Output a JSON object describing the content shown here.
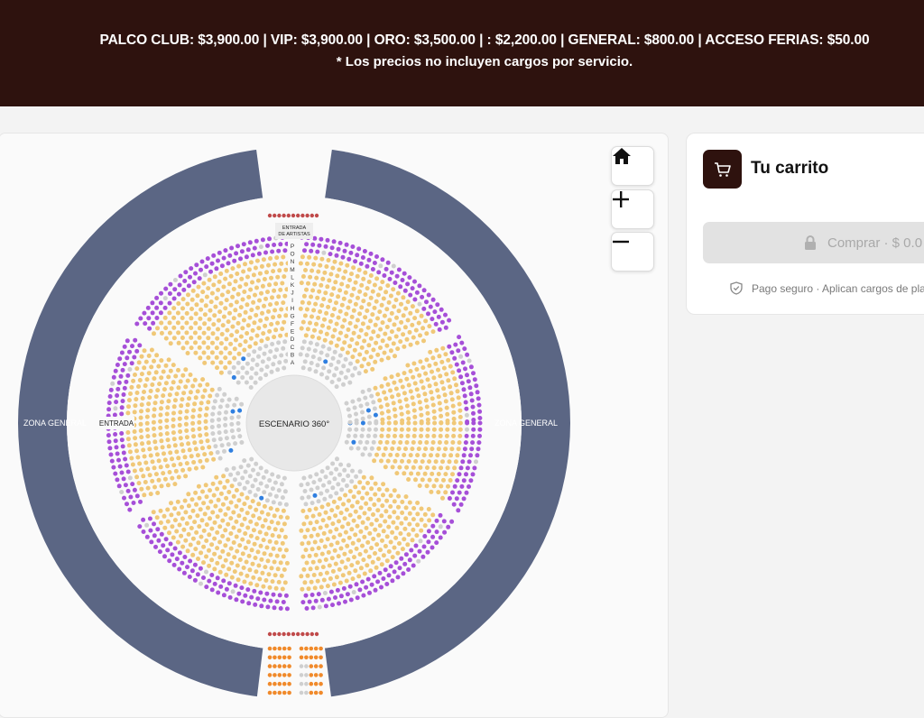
{
  "banner": {
    "prices": "PALCO CLUB: $3,900.00 | VIP: $3,900.00 | ORO: $3,500.00 | : $2,200.00 | GENERAL: $800.00 | ACCESO FERIAS: $50.00",
    "note": "* Los precios no incluyen cargos por servicio."
  },
  "map": {
    "zone_left": "ZONA GENERAL",
    "zone_right": "ZONA GENERAL",
    "stage": "ESCENARIO 360°",
    "entrance": "ENTRADA",
    "artists_entrance_line1": "ENTRADA",
    "artists_entrance_line2": "DE ARTISTAS",
    "rows": [
      "P",
      "O",
      "N",
      "M",
      "L",
      "K",
      "J",
      "I",
      "H",
      "G",
      "F",
      "E",
      "D",
      "C",
      "B",
      "A"
    ],
    "colors": {
      "general_zone": "#5b6684",
      "palco": "#c04a4a",
      "vip": "#a64fd8",
      "oro": "#f0c878",
      "unavailable": "#cfcfcf",
      "selected": "#2f7fe0",
      "orange_section": "#f08a2b"
    },
    "controls": {
      "home_icon": "home-icon",
      "zoom_in_icon": "plus-icon",
      "zoom_out_icon": "minus-icon"
    }
  },
  "cart": {
    "title": "Tu carrito",
    "icon": "cart-icon",
    "buy_label": "Comprar · $ 0.0",
    "secure_text": "Pago seguro · Aplican cargos de pla"
  }
}
